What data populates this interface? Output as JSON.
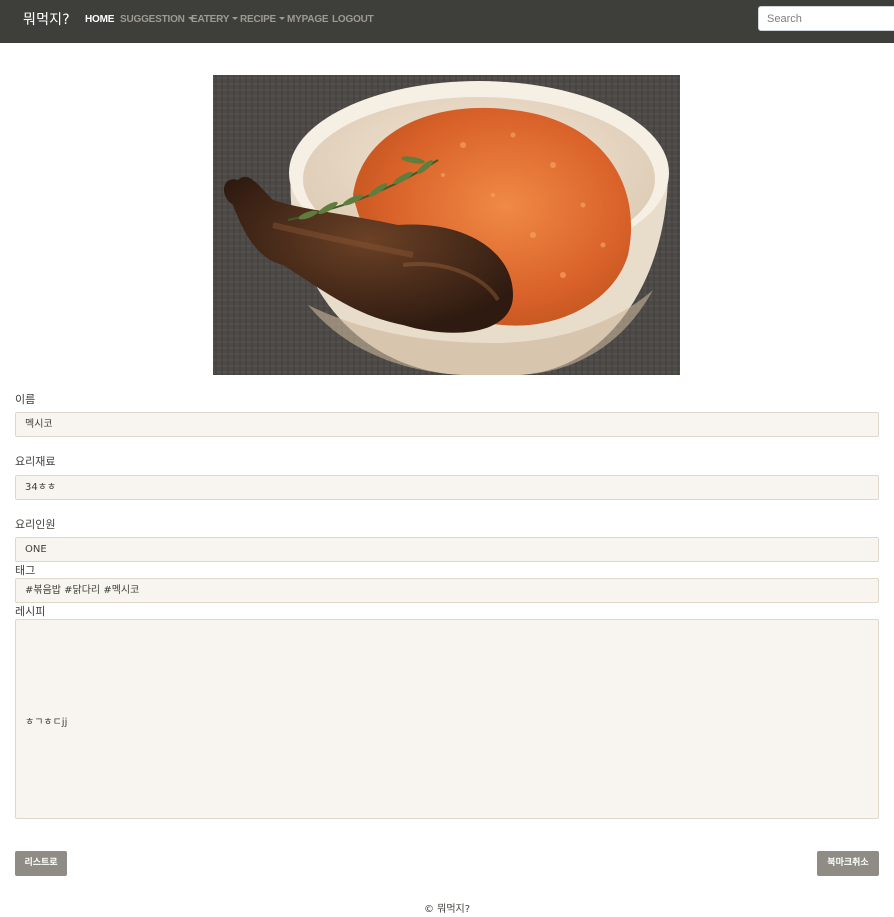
{
  "navbar": {
    "brand": "뭐먹지?",
    "items": [
      {
        "label": "HOME",
        "active": true,
        "dropdown": false
      },
      {
        "label": "SUGGESTION",
        "active": false,
        "dropdown": true
      },
      {
        "label": "EATERY",
        "active": false,
        "dropdown": true
      },
      {
        "label": "RECIPE",
        "active": false,
        "dropdown": true
      },
      {
        "label": "MYPAGE",
        "active": false,
        "dropdown": false
      },
      {
        "label": "LOGOUT",
        "active": false,
        "dropdown": false
      }
    ],
    "search_placeholder": "Search"
  },
  "recipe": {
    "name_label": "이름",
    "name_value": "멕시코",
    "ingredients_label": "요리재료",
    "ingredients_value": "34ㅎㅎ",
    "servings_label": "요리인원",
    "servings_value": "ONE",
    "tags_label": "태그",
    "tags_value": "#볶음밥 #닭다리 #멕시코",
    "recipe_label": "레시피",
    "recipe_value": "ㅎㄱㅎㄷjj"
  },
  "buttons": {
    "list": "리스트로",
    "bookmark_cancel": "북마크취소"
  },
  "footer": "© 뭐먹지?",
  "colors": {
    "navbar_bg": "#3e3f3a",
    "field_bg": "#f8f5f0",
    "button_bg": "#8e8c84"
  },
  "icons": {
    "dropdown": "chevron-down-icon"
  }
}
